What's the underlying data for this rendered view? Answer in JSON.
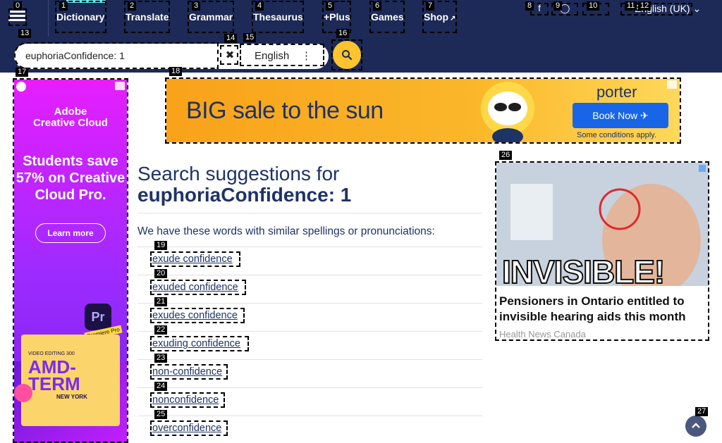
{
  "nav": {
    "items": [
      {
        "label": "Dictionary",
        "tag": "1"
      },
      {
        "label": "Translate",
        "tag": "2"
      },
      {
        "label": "Grammar",
        "tag": "3"
      },
      {
        "label": "Thesaurus",
        "tag": "4"
      },
      {
        "label": "+Plus",
        "tag": "5"
      },
      {
        "label": "Games",
        "tag": "6"
      },
      {
        "label": "Shop",
        "tag": "7"
      }
    ],
    "menu_tag": "0",
    "social_tags": [
      "8",
      "9",
      "10",
      "11"
    ],
    "language_tag": "12",
    "language_label": "English (UK)"
  },
  "search": {
    "value": "euphoriaConfidence: 1",
    "input_tag": "13",
    "clear_tag": "14",
    "lang_tag": "15",
    "lang_label": "English",
    "button_tag": "16"
  },
  "ads": {
    "left_tag": "17",
    "left_brand_line1": "Adobe",
    "left_brand_line2": "Creative Cloud",
    "left_headline": "Students save 57% on Creative Cloud Pro.",
    "left_cta": "Learn more",
    "left_pr": "Pr",
    "left_badge": "Premiere Pro",
    "left_art_title": "AMD-TERM",
    "left_art_sub": "NEW YORK",
    "left_art_top": "VIDEO EDITING 300",
    "top_tag": "18",
    "top_headline": "BIG sale to the sun",
    "top_brand": "porter",
    "top_cta": "Book Now",
    "top_conditions": "Some conditions apply.",
    "right_tag": "26",
    "right_overlay": "INVISIBLE!",
    "right_caption": "Pensioners in Ontario entitled to invisible hearing aids this month",
    "right_source": "Health News Canada"
  },
  "main": {
    "title_line1": "Search suggestions for",
    "title_line2": "euphoriaConfidence: 1",
    "lead": "We have these words with similar spellings or pronunciations:",
    "suggestions": [
      {
        "label": "exude confidence",
        "tag": "19"
      },
      {
        "label": "exuded confidence",
        "tag": "20"
      },
      {
        "label": "exudes confidence",
        "tag": "21"
      },
      {
        "label": "exuding confidence",
        "tag": "22"
      },
      {
        "label": "non-confidence",
        "tag": "23"
      },
      {
        "label": "nonconfidence",
        "tag": "24"
      },
      {
        "label": "overconfidence",
        "tag": "25"
      }
    ]
  },
  "scroll_top_tag": "27",
  "colors": {
    "navy": "#1d2a57",
    "accent": "#fec42d",
    "text": "#1e3366"
  }
}
